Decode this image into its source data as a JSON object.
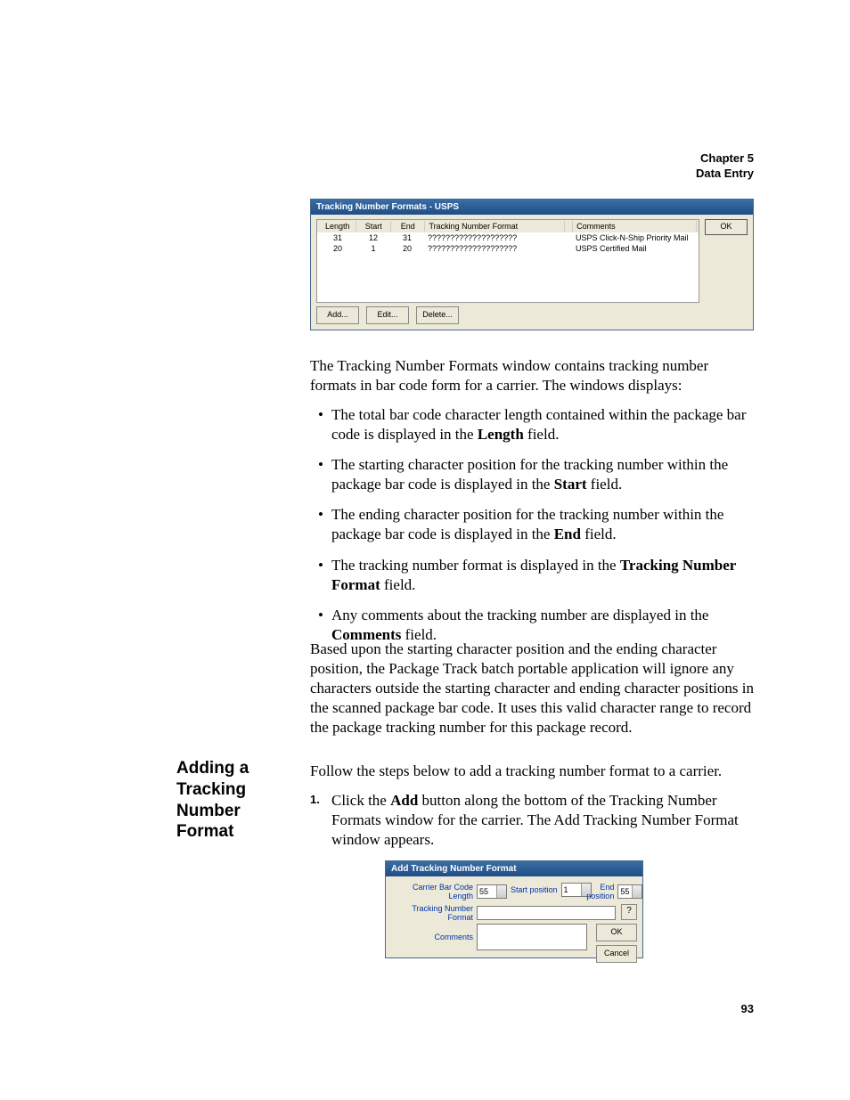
{
  "header": {
    "chapter": "Chapter 5",
    "title": "Data Entry"
  },
  "screenshot1": {
    "title": "Tracking Number Formats - USPS",
    "columns": {
      "length": "Length",
      "start": "Start",
      "end": "End",
      "format": "Tracking Number Format",
      "comments": "Comments"
    },
    "rows": [
      {
        "length": "31",
        "start": "12",
        "end": "31",
        "format": "????????????????????",
        "comments": "USPS Click-N-Ship Priority Mail"
      },
      {
        "length": "20",
        "start": "1",
        "end": "20",
        "format": "????????????????????",
        "comments": "USPS Certified Mail"
      }
    ],
    "ok": "OK",
    "add": "Add...",
    "edit": "Edit...",
    "delete": "Delete..."
  },
  "para1": "The Tracking Number Formats window contains tracking number formats in bar code form for a carrier. The windows displays:",
  "bullets": [
    {
      "pre": " The total bar code character length contained within the package bar code is displayed in the ",
      "bold": "Length",
      "post": " field."
    },
    {
      "pre": "The starting character position for the tracking number within the package bar code is displayed in the ",
      "bold": "Start",
      "post": " field."
    },
    {
      "pre": "The ending character position for the tracking number within the package bar code is displayed in the ",
      "bold": "End",
      "post": " field."
    },
    {
      "pre": "The tracking number format is displayed in the ",
      "bold": "Tracking Number Format",
      "post": " field."
    },
    {
      "pre": "Any comments about the tracking number are displayed in the ",
      "bold": "Comments",
      "post": " field."
    }
  ],
  "para2": "Based upon the starting character position and the ending character position, the Package Track batch portable application will ignore any characters outside the starting character and ending character positions in the scanned package bar code. It uses this valid character range to record the package tracking number for this package record.",
  "sidehead": "Adding a Tracking Number Format",
  "para3": "Follow the steps below to add a tracking number format to a carrier.",
  "step1": {
    "num": "1.",
    "pre": "Click the ",
    "bold": "Add",
    "post": " button along the bottom of the Tracking Number Formats window for the carrier. The Add Tracking Number Format window appears."
  },
  "screenshot2": {
    "title": "Add Tracking Number Format",
    "labels": {
      "barcode": "Carrier Bar Code Length",
      "start": "Start position",
      "end": "End position",
      "format": "Tracking Number Format",
      "comments": "Comments"
    },
    "values": {
      "barcode": "55",
      "start": "1",
      "end": "55"
    },
    "help": "?",
    "ok": "OK",
    "cancel": "Cancel"
  },
  "pagenum": "93"
}
